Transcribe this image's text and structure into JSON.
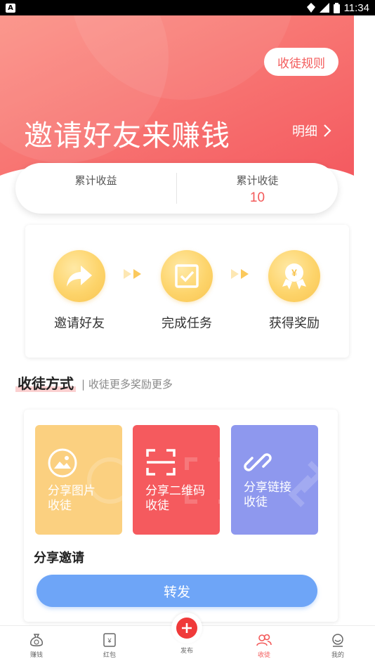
{
  "status_bar": {
    "time": "11:34",
    "left_badge": "A"
  },
  "hero": {
    "title": "邀请好友来赚钱",
    "rules_button": "收徒规则",
    "detail_link": "明细"
  },
  "stats": {
    "income_label": "累计收益",
    "income_value": "",
    "apprentices_label": "累计收徒",
    "apprentices_value": "10"
  },
  "steps": [
    {
      "label": "邀请好友",
      "icon": "share-arrow-icon"
    },
    {
      "label": "完成任务",
      "icon": "checkbox-icon"
    },
    {
      "label": "获得奖励",
      "icon": "reward-medal-icon"
    }
  ],
  "section": {
    "title": "收徒方式",
    "subtitle": "| 收徒更多奖励更多"
  },
  "methods": [
    {
      "label": "分享图片收徒",
      "line1": "分享图片",
      "line2": "收徒",
      "color": "#fbd080",
      "icon": "image-icon"
    },
    {
      "label": "分享二维码收徒",
      "line1": "分享二维码",
      "line2": "收徒",
      "color": "#f55a5e",
      "icon": "qr-scan-icon"
    },
    {
      "label": "分享链接收徒",
      "line1": "分享链接",
      "line2": "收徒",
      "color": "#8e98ee",
      "icon": "link-icon"
    }
  ],
  "share": {
    "label": "分享邀请",
    "forward_button": "转发"
  },
  "bottom_nav": {
    "items": [
      {
        "label": "赚钱",
        "icon": "money-bag-icon"
      },
      {
        "label": "红包",
        "icon": "red-envelope-icon"
      },
      {
        "label": "发布",
        "icon": "plus-icon"
      },
      {
        "label": "收徒",
        "icon": "people-icon",
        "active": true
      },
      {
        "label": "我的",
        "icon": "profile-icon"
      }
    ]
  },
  "colors": {
    "accent": "#f35a5a",
    "hero_gradient_start": "#fb8a7e",
    "hero_gradient_end": "#f45f63",
    "forward_button": "#6ea5f7"
  }
}
